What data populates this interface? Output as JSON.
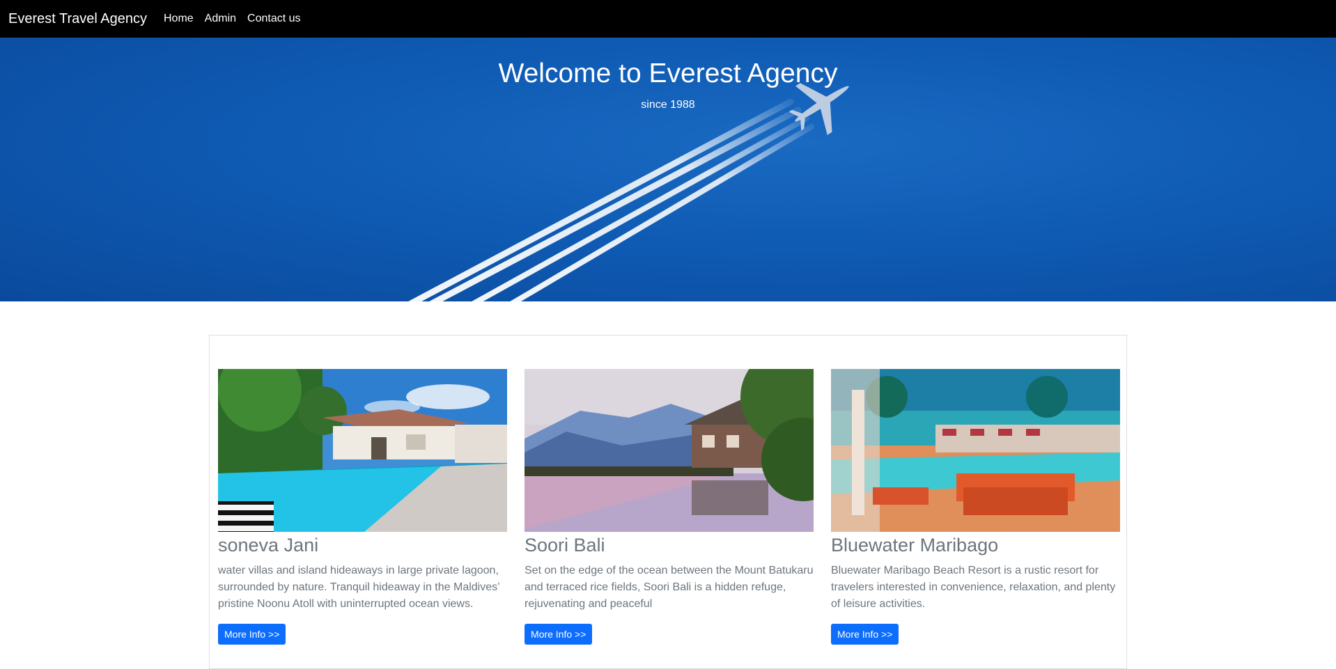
{
  "navbar": {
    "brand": "Everest Travel Agency",
    "links": [
      "Home",
      "Admin",
      "Contact us"
    ]
  },
  "hero": {
    "title": "Welcome to Everest Agency",
    "subtitle": "since 1988"
  },
  "cards": [
    {
      "title": "soneva Jani",
      "text": "water villas and island hideaways in large private lagoon, surrounded by nature. Tranquil hideaway in the Maldives’ pristine Noonu Atoll with uninterrupted ocean views.",
      "button": "More Info >>"
    },
    {
      "title": "Soori Bali",
      "text": "Set on the edge of the ocean between the Mount Batukaru and terraced rice fields, Soori Bali is a hidden refuge, rejuvenating and peaceful",
      "button": "More Info >>"
    },
    {
      "title": "Bluewater Maribago",
      "text": "Bluewater Maribago Beach Resort is a rustic resort for travelers interested in convenience, relaxation, and plenty of leisure activities.",
      "button": "More Info >>"
    }
  ],
  "colors": {
    "navbar": "#000000",
    "hero_blue": "#0f5bb4",
    "button": "#0d6efd",
    "muted_text": "#6c757d"
  }
}
